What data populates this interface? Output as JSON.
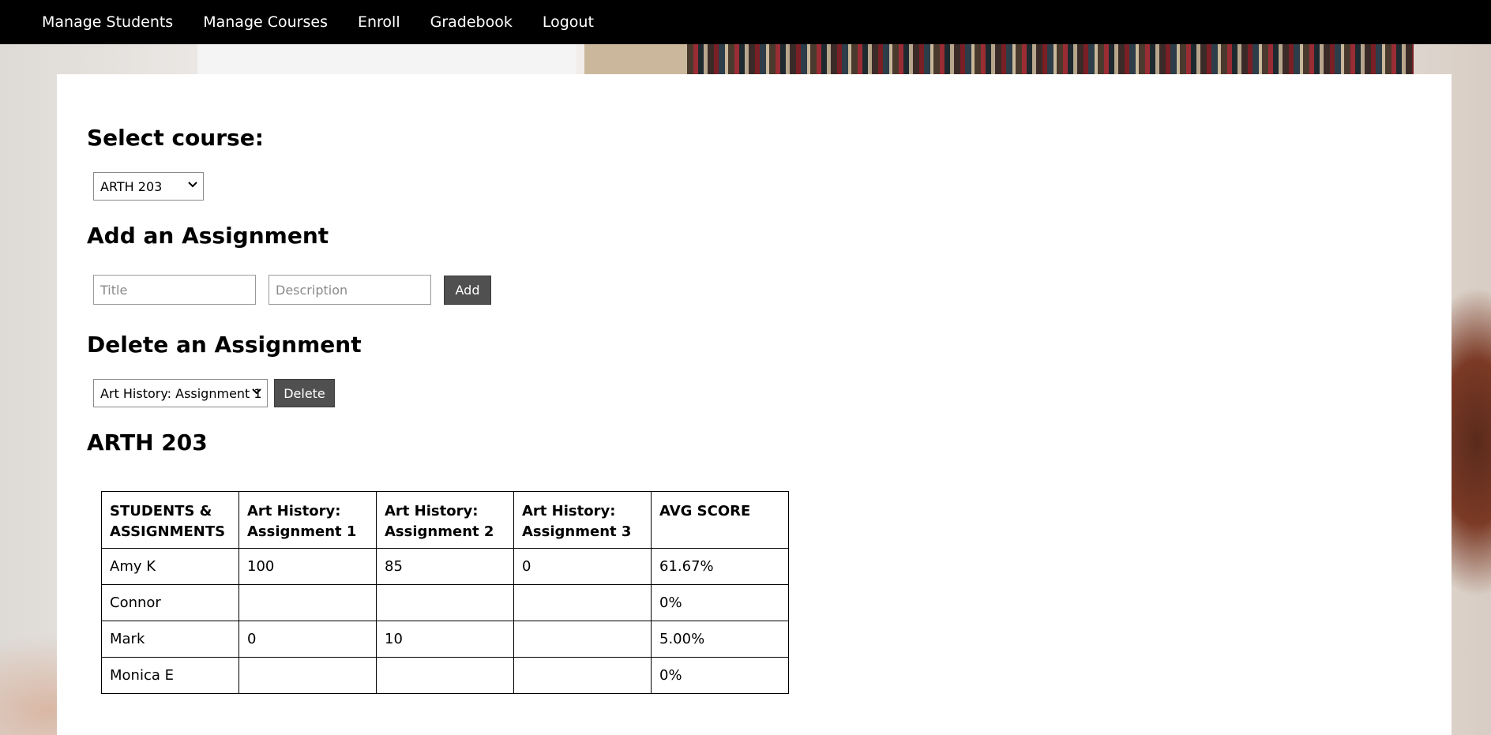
{
  "nav": {
    "items": [
      {
        "label": "Manage Students"
      },
      {
        "label": "Manage Courses"
      },
      {
        "label": "Enroll"
      },
      {
        "label": "Gradebook"
      },
      {
        "label": "Logout"
      }
    ]
  },
  "select_course": {
    "heading": "Select course:",
    "selected": "ARTH 203"
  },
  "add_assignment": {
    "heading": "Add an Assignment",
    "title_placeholder": "Title",
    "description_placeholder": "Description",
    "button_label": "Add"
  },
  "delete_assignment": {
    "heading": "Delete an Assignment",
    "selected": "Art History: Assignment 1",
    "button_label": "Delete"
  },
  "gradebook": {
    "course_heading": "ARTH 203",
    "headers": [
      "STUDENTS & ASSIGNMENTS",
      "Art History: Assignment 1",
      "Art History: Assignment 2",
      "Art History: Assignment 3",
      "AVG SCORE"
    ],
    "rows": [
      [
        "Amy K",
        "100",
        "85",
        "0",
        "61.67%"
      ],
      [
        "Connor",
        "",
        "",
        "",
        "0%"
      ],
      [
        "Mark",
        "0",
        "10",
        "",
        "5.00%"
      ],
      [
        "Monica E",
        "",
        "",
        "",
        "0%"
      ]
    ]
  }
}
